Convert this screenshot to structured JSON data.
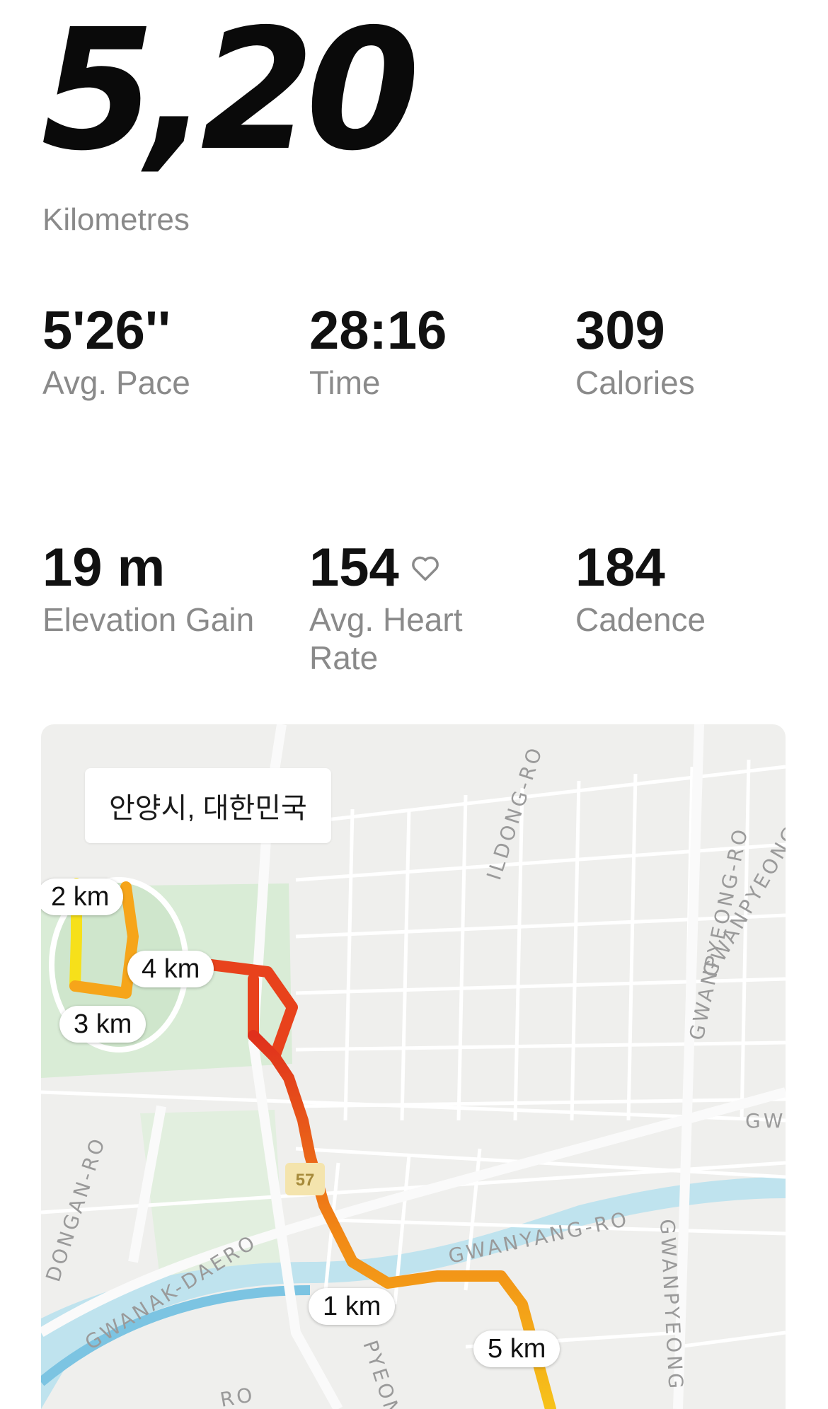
{
  "summary": {
    "distance": "5,20",
    "distance_unit": "Kilometres"
  },
  "stats": [
    {
      "value": "5'26''",
      "label": "Avg. Pace"
    },
    {
      "value": "28:16",
      "label": "Time"
    },
    {
      "value": "309",
      "label": "Calories"
    },
    {
      "value": "19 m",
      "label": "Elevation Gain"
    },
    {
      "value": "154",
      "label": "Avg. Heart Rate",
      "icon": "heart-outline-icon"
    },
    {
      "value": "184",
      "label": "Cadence"
    }
  ],
  "map": {
    "location": "안양시, 대한민국",
    "km_markers": [
      "2 km",
      "4 km",
      "3 km",
      "1 km",
      "5 km"
    ],
    "street_labels": [
      "ILDONG-RO",
      "GWANPYEONG-RO",
      "GWANPYEONG-R",
      "DONGAN-RO",
      "GWANAK-DAERO",
      "GWANYANG-RO",
      "GWANPYEONG",
      "GW",
      "PYEONG",
      "RO"
    ],
    "road_badge": "57",
    "colors": {
      "route_slow": "#f6c21a",
      "route_mid": "#f28b16",
      "route_fast": "#e0301c",
      "park": "#d9ecd6",
      "river": "#bfe3ee",
      "map_bg": "#efefed"
    }
  }
}
